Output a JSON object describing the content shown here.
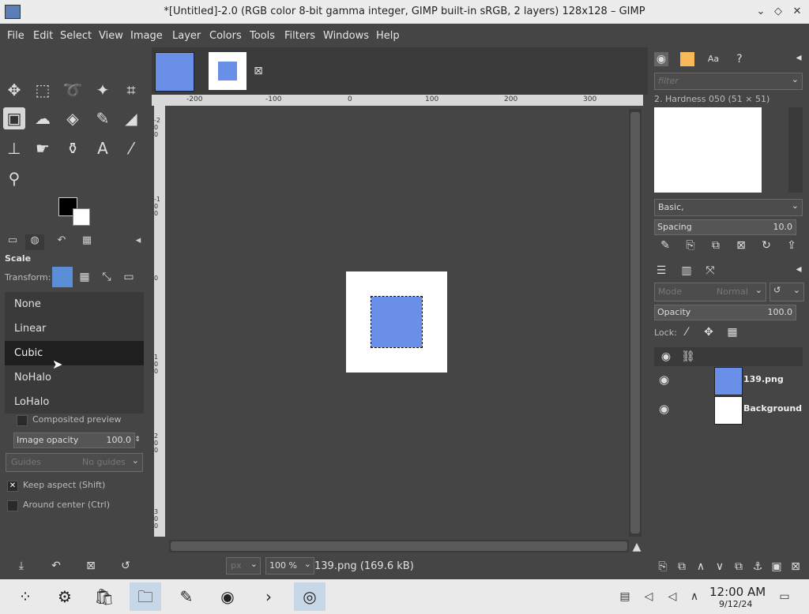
{
  "titlebar": {
    "title": "*[Untitled]-2.0 (RGB color 8-bit gamma integer, GIMP built-in sRGB, 2 layers) 128x128 – GIMP",
    "buttons": {
      "minimize": "⌄",
      "maximize": "◇",
      "close": "✕"
    }
  },
  "menubar": {
    "items": [
      "File",
      "Edit",
      "Select",
      "View",
      "Image",
      "Layer",
      "Colors",
      "Tools",
      "Filters",
      "Windows",
      "Help"
    ]
  },
  "tool_options": {
    "tool_name": "Scale",
    "transform_label": "Transform:",
    "interpolation_options": [
      "None",
      "Linear",
      "Cubic",
      "NoHalo",
      "LoHalo"
    ],
    "selected_interpolation": "Cubic",
    "composited_preview": "Composited preview",
    "image_opacity_label": "Image opacity",
    "image_opacity_value": "100.0",
    "guides_label": "Guides",
    "guides_value": "No guides",
    "keep_aspect": "Keep aspect (Shift)",
    "around_center": "Around center (Ctrl)"
  },
  "rulers": {
    "h_ticks": [
      "-200",
      "-100",
      "0",
      "100",
      "200",
      "300"
    ],
    "v_ticks": [
      "-200",
      "-100",
      "0",
      "100",
      "200",
      "300"
    ]
  },
  "statusbar": {
    "unit": "px",
    "zoom": "100 %",
    "file_info": "139.png (169.6 kB)"
  },
  "brushes": {
    "filter_placeholder": "filter",
    "current_brush": "2. Hardness 050 (51 × 51)",
    "preset": "Basic,",
    "spacing_label": "Spacing",
    "spacing_value": "10.0"
  },
  "layers": {
    "mode_label": "Mode",
    "mode_value": "Normal",
    "opacity_label": "Opacity",
    "opacity_value": "100.0",
    "lock_label": "Lock:",
    "items": [
      {
        "name": "139.png"
      },
      {
        "name": "Background"
      }
    ]
  },
  "taskbar": {
    "time": "12:00 AM",
    "date": "9/12/24"
  }
}
